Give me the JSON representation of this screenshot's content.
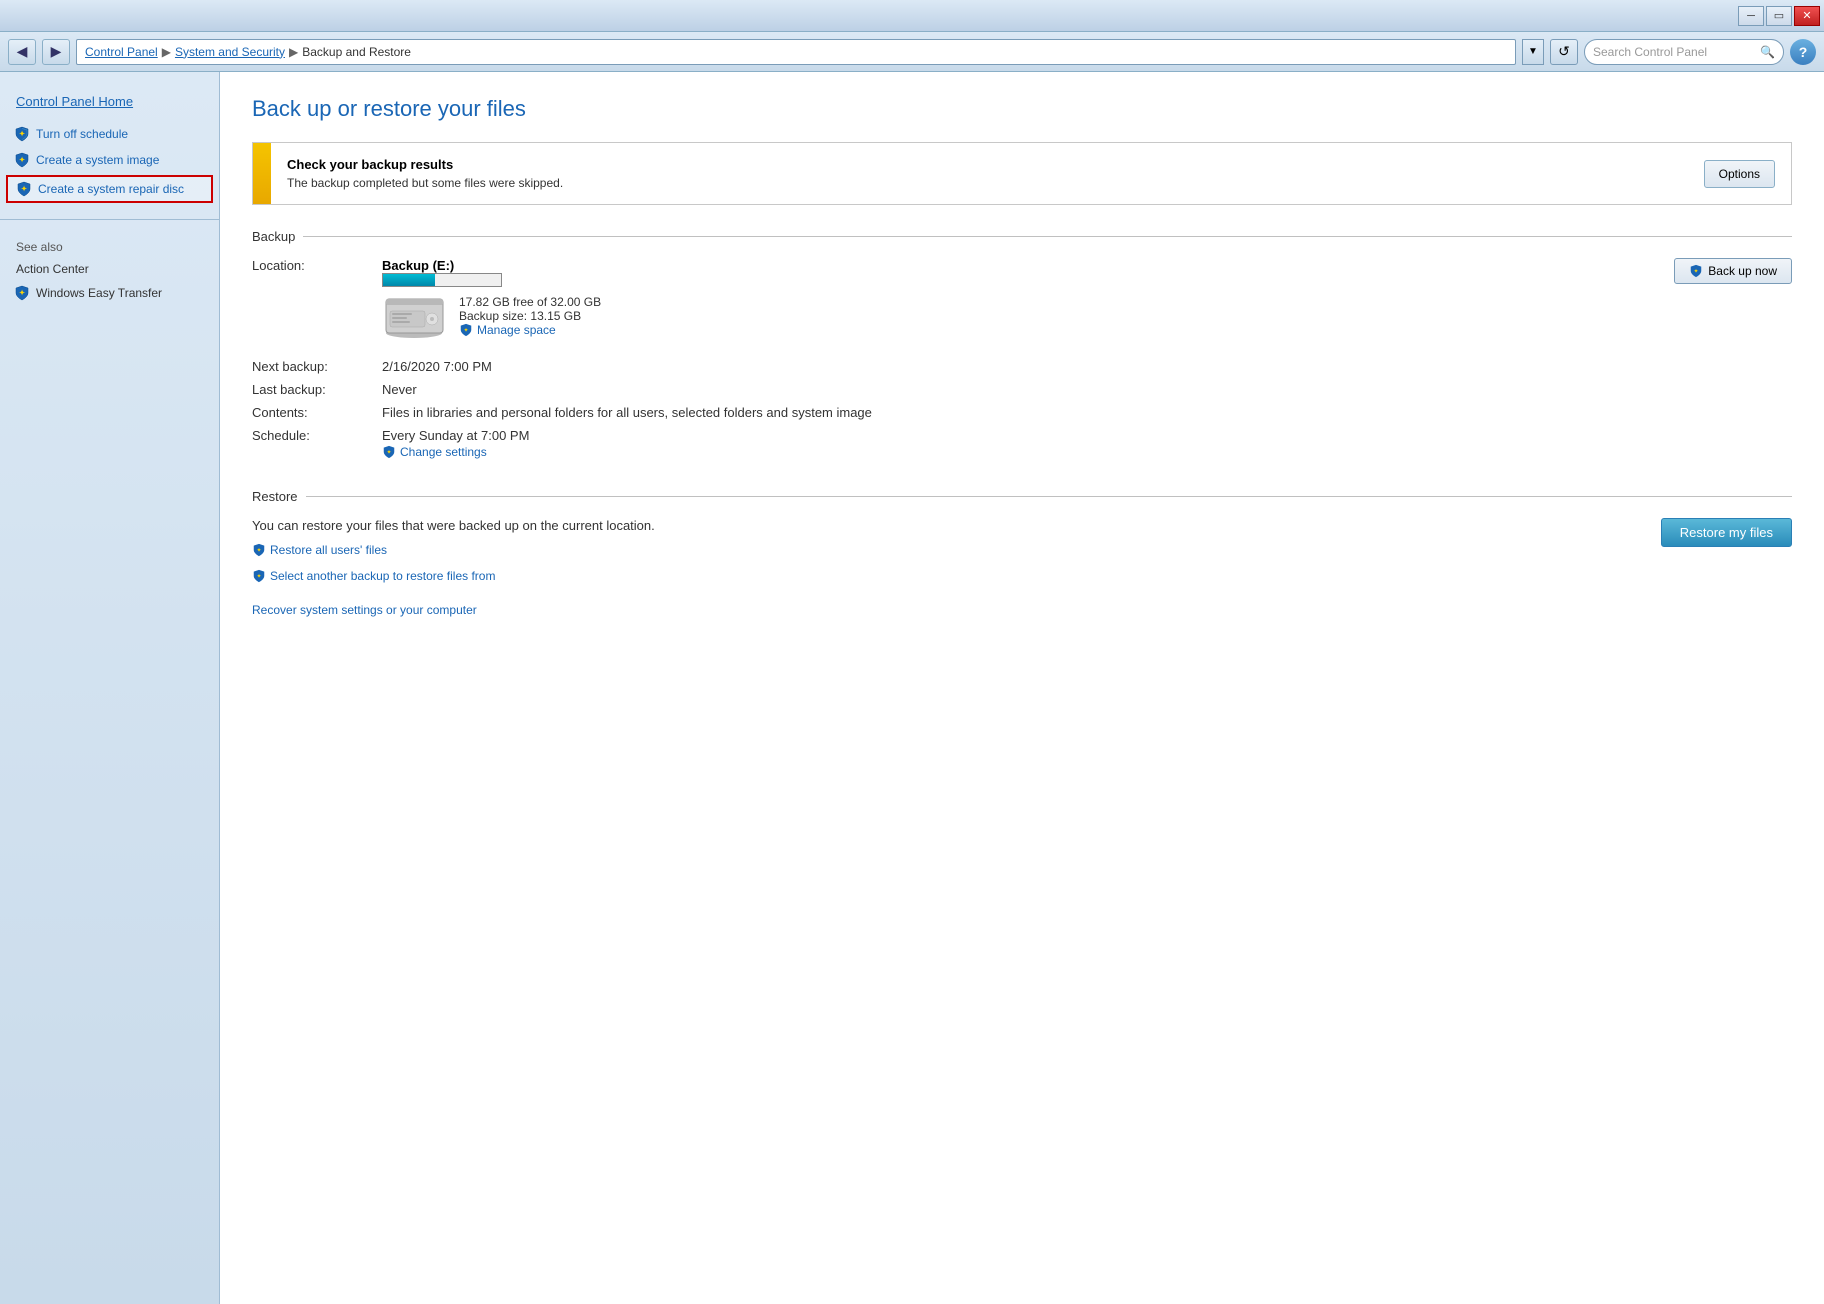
{
  "titlebar": {
    "minimize_label": "─",
    "maximize_label": "▭",
    "close_label": "✕"
  },
  "addressbar": {
    "back_label": "◀",
    "forward_label": "▶",
    "path": "Control Panel  ▶  System and Security  ▶  Backup and Restore",
    "path_parts": [
      "Control Panel",
      "System and Security",
      "Backup and Restore"
    ],
    "dropdown_label": "▼",
    "refresh_label": "↺",
    "search_placeholder": "Search Control Panel",
    "help_label": "?"
  },
  "sidebar": {
    "home_label": "Control Panel Home",
    "items": [
      {
        "label": "Turn off schedule",
        "has_shield": true
      },
      {
        "label": "Create a system image",
        "has_shield": true
      },
      {
        "label": "Create a system repair disc",
        "has_shield": true,
        "highlighted": true
      }
    ],
    "see_also_label": "See also",
    "extra_items": [
      {
        "label": "Action Center",
        "has_shield": false
      },
      {
        "label": "Windows Easy Transfer",
        "has_shield": true
      }
    ]
  },
  "content": {
    "page_title": "Back up or restore your files",
    "warning": {
      "title": "Check your backup results",
      "text": "The backup completed but some files were skipped.",
      "options_button": "Options"
    },
    "backup_section": {
      "header": "Backup",
      "location_label": "Location:",
      "location_value": "Backup (E:)",
      "disk_free": "17.82 GB free of 32.00 GB",
      "progress_percent": 44,
      "backup_size_label": "Backup size:",
      "backup_size_value": "13.15 GB",
      "manage_link": "Manage space",
      "backup_now_button": "Back up now",
      "next_backup_label": "Next backup:",
      "next_backup_value": "2/16/2020 7:00 PM",
      "last_backup_label": "Last backup:",
      "last_backup_value": "Never",
      "contents_label": "Contents:",
      "contents_value": "Files in libraries and personal folders for all users, selected folders and system image",
      "schedule_label": "Schedule:",
      "schedule_value": "Every Sunday at 7:00 PM",
      "change_settings_link": "Change settings"
    },
    "restore_section": {
      "header": "Restore",
      "desc": "You can restore your files that were backed up on the current location.",
      "restore_my_files_button": "Restore my files",
      "restore_all_link": "Restore all users' files",
      "select_another_link": "Select another backup to restore files from",
      "recover_link": "Recover system settings or your computer"
    }
  }
}
